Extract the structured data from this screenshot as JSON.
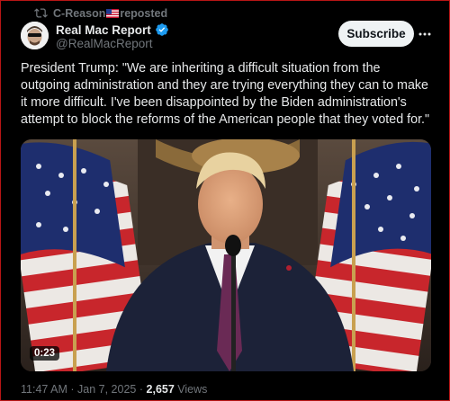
{
  "repost": {
    "label": "C-Reason",
    "suffix": "reposted"
  },
  "author": {
    "name": "Real Mac Report",
    "handle": "@RealMacReport",
    "verified": true
  },
  "actions": {
    "subscribe_label": "Subscribe"
  },
  "tweet": {
    "text": "President Trump: \"We are inheriting a difficult situation from the\noutgoing administration and they are trying everything they can to make\nit more difficult. I've been disappointed by the Biden administration's\nattempt to block the reforms of the American people that they voted for.\""
  },
  "video": {
    "duration": "0:23"
  },
  "meta": {
    "time": "11:47 AM",
    "date": "Jan 7, 2025",
    "views_count": "2,657",
    "views_label": "Views",
    "separator": "·"
  },
  "colors": {
    "background": "#000000",
    "text": "#e7e9ea",
    "muted": "#71767b",
    "verified": "#1d9bf0",
    "button_bg": "#eff3f4",
    "frame_border": "#b81616"
  },
  "icons": {
    "repost": "repost-icon",
    "flag": "us-flag-icon",
    "verified": "verified-badge-icon",
    "more": "more-options-icon"
  }
}
